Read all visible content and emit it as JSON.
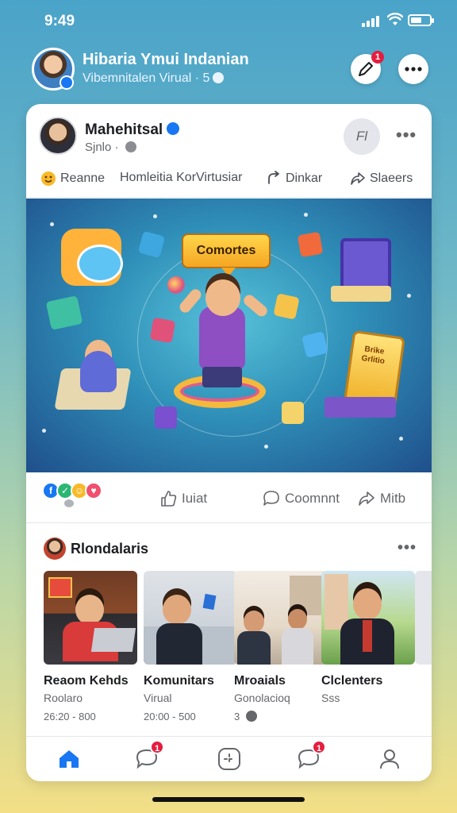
{
  "status_bar": {
    "time": "9:49",
    "battery_level": 0.6
  },
  "header": {
    "title": "Hibaria Ymui Indanian",
    "subtitle": "Vibemnitalen Virual · 5",
    "edit_badge": "1"
  },
  "post": {
    "author": "Mahehitsal",
    "meta": "Sjnlo ·",
    "follow_label": "Fl",
    "actions": [
      {
        "label": "Reanne",
        "icon": "emoji-icon"
      },
      {
        "label": "Homleitia KorVirtusiar",
        "icon": ""
      },
      {
        "label": "Dinkar",
        "icon": "link-icon"
      },
      {
        "label": "Slaeers",
        "icon": "share-icon"
      }
    ],
    "image": {
      "banner": "Comortes",
      "gold_sign": "Brike Grlitio"
    },
    "reactions_row": {
      "like_label": "Iuiat",
      "comment_label": "Coomnnt",
      "share_label": "Mitb"
    }
  },
  "groups": {
    "title": "Rlondalaris",
    "items": [
      {
        "title": "Reaom Kehds",
        "subtitle": "Roolaro",
        "meta": "26:20 - 800"
      },
      {
        "title": "Komunitars",
        "subtitle": "Virual",
        "meta": "20:00 - 500"
      },
      {
        "title": "Mroaials",
        "subtitle": "Gonolacioq",
        "meta": "3"
      },
      {
        "title": "Clclenters",
        "subtitle": "Sss",
        "meta": ""
      }
    ]
  },
  "nav": {
    "items": [
      {
        "name": "home",
        "badge": ""
      },
      {
        "name": "messages",
        "badge": "1"
      },
      {
        "name": "create",
        "badge": ""
      },
      {
        "name": "notifications",
        "badge": "1"
      },
      {
        "name": "profile",
        "badge": ""
      }
    ]
  },
  "colors": {
    "accent": "#1877f2",
    "badge": "#e41e3f"
  }
}
